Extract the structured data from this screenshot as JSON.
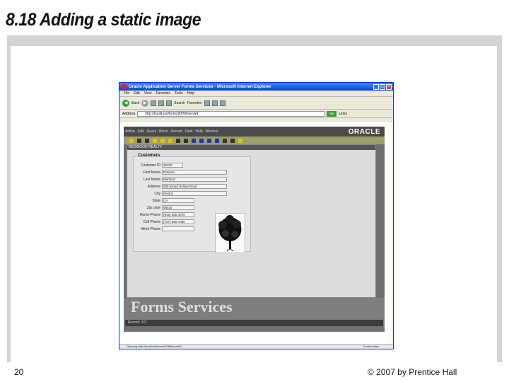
{
  "slide": {
    "title": "8.18 Adding a static image",
    "page_number": "20",
    "copyright": "© 2007 by Prentice Hall"
  },
  "browser": {
    "title": "Oracle Application Server Forms Services - Microsoft Internet Explorer",
    "menu": [
      "File",
      "Edit",
      "View",
      "Favorites",
      "Tools",
      "Help"
    ],
    "toolbar": {
      "back_label": "Back",
      "search_label": "Search",
      "favorites_label": "Favorites"
    },
    "address_label": "Address",
    "address_value": "http://localhost/forms90/f90servlet",
    "go_label": "Go",
    "links_label": "Links",
    "status_text": "Opening http://localhost/forms90/f90servlet?...",
    "status_zone": "Trusted sites"
  },
  "oracle_app": {
    "logo": "ORACLE",
    "menu": [
      "Action",
      "Edit",
      "Query",
      "Block",
      "Record",
      "Field",
      "Help",
      "Window"
    ],
    "form_title": "REDWOOD REALTY",
    "watermark": "Forms Services",
    "record_status": "Record: 1/2",
    "customers": {
      "title": "Customers",
      "fields": [
        {
          "label": "Customer ID",
          "value": "25100"
        },
        {
          "label": "First Name",
          "value": "Roberto"
        },
        {
          "label": "Last Name",
          "value": "Martinez"
        },
        {
          "label": "Address",
          "value": "505 Broad Hollow Road"
        },
        {
          "label": "City",
          "value": "Reston"
        },
        {
          "label": "State",
          "value": "CA"
        },
        {
          "label": "Zip code",
          "value": "95616"
        },
        {
          "label": "Home Phone",
          "value": "(916) 555-4070"
        },
        {
          "label": "Cell Phone",
          "value": "(707) 555-7080"
        },
        {
          "label": "Work Phone",
          "value": ""
        }
      ]
    }
  }
}
